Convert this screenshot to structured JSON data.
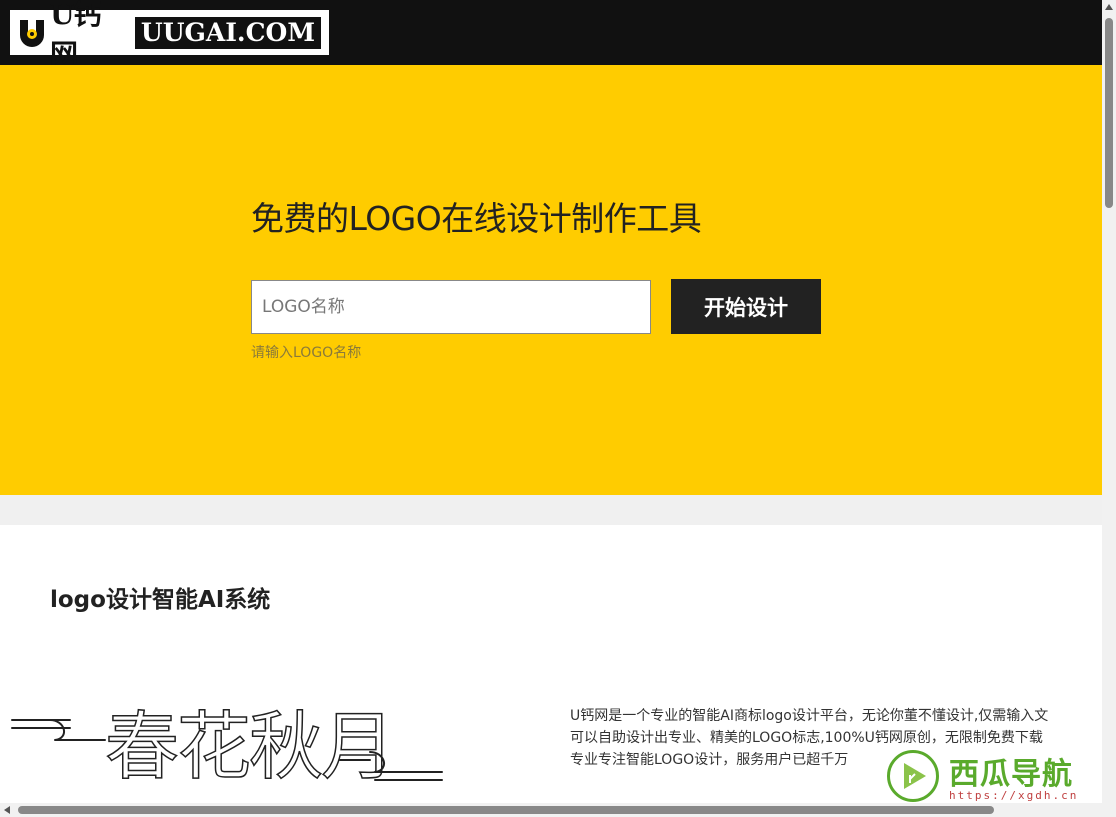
{
  "header": {
    "logo_cn": "U钙网",
    "logo_en": "UUGAI.COM"
  },
  "hero": {
    "title": "免费的LOGO在线设计制作工具",
    "input_placeholder": "LOGO名称",
    "button_label": "开始设计",
    "hint": "请输入LOGO名称"
  },
  "section": {
    "title": "logo设计智能AI系统",
    "art_text": "春花秋月",
    "desc_lines": [
      "U钙网是一个专业的智能AI商标logo设计平台，无论你董不懂设计,仅需输入文",
      "可以自助设计出专业、精美的LOGO标志,100%U钙网原创，无限制免费下载",
      "专业专注智能LOGO设计，服务用户已超千万"
    ]
  },
  "watermark": {
    "text": "西瓜导航",
    "url": "https://xgdh.cn"
  },
  "colors": {
    "hero_bg": "#ffcc00",
    "topbar_bg": "#111111",
    "button_bg": "#222222",
    "watermark_green": "#5aaa2c"
  }
}
